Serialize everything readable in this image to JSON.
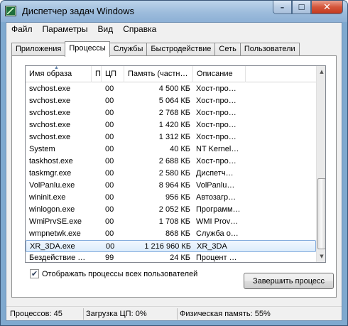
{
  "window": {
    "title": "Диспетчер задач Windows",
    "buttons": {
      "minimize": "–",
      "maximize": "☐",
      "close": "✕"
    }
  },
  "menu": [
    "Файл",
    "Параметры",
    "Вид",
    "Справка"
  ],
  "tabs": [
    {
      "label": "Приложения",
      "active": false
    },
    {
      "label": "Процессы",
      "active": true
    },
    {
      "label": "Службы",
      "active": false
    },
    {
      "label": "Быстродействие",
      "active": false
    },
    {
      "label": "Сеть",
      "active": false
    },
    {
      "label": "Пользователи",
      "active": false
    }
  ],
  "table": {
    "headers": {
      "name": "Имя образа",
      "user": "П",
      "cpu": "ЦП",
      "memory": "Память (частн…",
      "description": "Описание"
    },
    "rows": [
      {
        "name": "svchost.exe",
        "cpu": "00",
        "memory": "4 500 КБ",
        "description": "Хост-про…"
      },
      {
        "name": "svchost.exe",
        "cpu": "00",
        "memory": "5 064 КБ",
        "description": "Хост-про…"
      },
      {
        "name": "svchost.exe",
        "cpu": "00",
        "memory": "2 768 КБ",
        "description": "Хост-про…"
      },
      {
        "name": "svchost.exe",
        "cpu": "00",
        "memory": "1 420 КБ",
        "description": "Хост-про…"
      },
      {
        "name": "svchost.exe",
        "cpu": "00",
        "memory": "1 312 КБ",
        "description": "Хост-про…"
      },
      {
        "name": "System",
        "cpu": "00",
        "memory": "40 КБ",
        "description": "NT Kernel…"
      },
      {
        "name": "taskhost.exe",
        "cpu": "00",
        "memory": "2 688 КБ",
        "description": "Хост-про…"
      },
      {
        "name": "taskmgr.exe",
        "cpu": "00",
        "memory": "2 580 КБ",
        "description": "Диспетч…"
      },
      {
        "name": "VolPanlu.exe",
        "cpu": "00",
        "memory": "8 964 КБ",
        "description": "VolPanlu…"
      },
      {
        "name": "wininit.exe",
        "cpu": "00",
        "memory": "956 КБ",
        "description": "Автозагр…"
      },
      {
        "name": "winlogon.exe",
        "cpu": "00",
        "memory": "2 052 КБ",
        "description": "Программ…"
      },
      {
        "name": "WmiPrvSE.exe",
        "cpu": "00",
        "memory": "1 708 КБ",
        "description": "WMI Prov…"
      },
      {
        "name": "wmpnetwk.exe",
        "cpu": "00",
        "memory": "868 КБ",
        "description": "Служба о…"
      },
      {
        "name": "XR_3DA.exe",
        "cpu": "00",
        "memory": "1 216 960 КБ",
        "description": "XR_3DA",
        "selected": true
      },
      {
        "name": "Бездействие …",
        "cpu": "99",
        "memory": "24 КБ",
        "description": "Процент …"
      }
    ]
  },
  "show_all_users": {
    "label": "Отображать процессы всех пользователей",
    "checked": true,
    "mark": "✔"
  },
  "end_process_button": "Завершить процесс",
  "status": {
    "processes": "Процессов: 45",
    "cpu_load": "Загрузка ЦП: 0%",
    "physical_memory": "Физическая память: 55%"
  },
  "scrollbar": {
    "up": "▲",
    "down": "▼"
  }
}
